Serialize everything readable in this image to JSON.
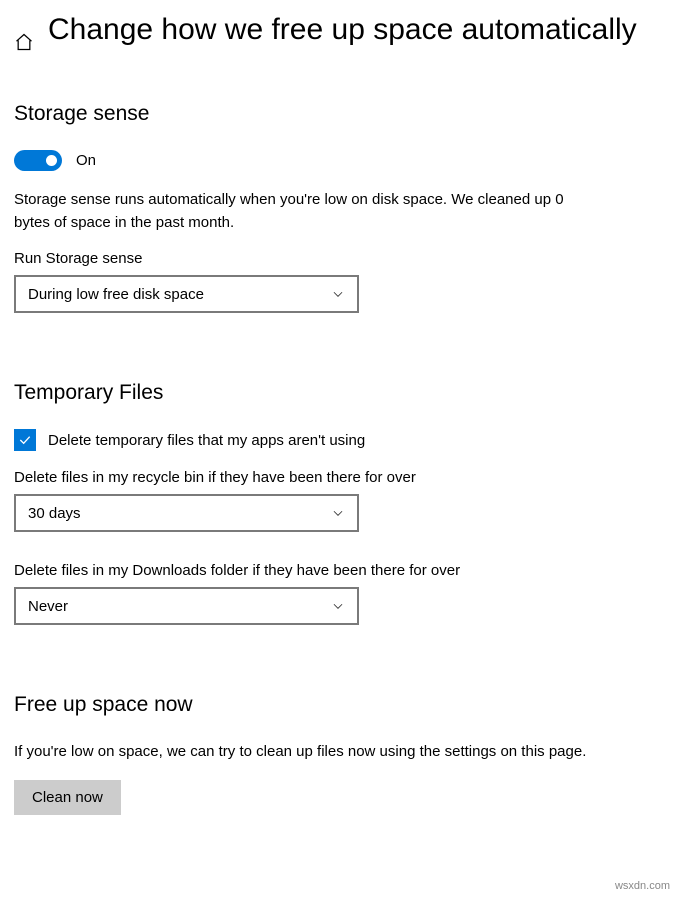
{
  "header": {
    "title": "Change how we free up space automatically"
  },
  "storageSense": {
    "heading": "Storage sense",
    "toggleLabel": "On",
    "description": "Storage sense runs automatically when you're low on disk space. We cleaned up 0 bytes of space in the past month.",
    "runLabel": "Run Storage sense",
    "runValue": "During low free disk space"
  },
  "temporaryFiles": {
    "heading": "Temporary Files",
    "checkboxLabel": "Delete temporary files that my apps aren't using",
    "recycleBinLabel": "Delete files in my recycle bin if they have been there for over",
    "recycleBinValue": "30 days",
    "downloadsLabel": "Delete files in my Downloads folder if they have been there for over",
    "downloadsValue": "Never"
  },
  "freeUpSpace": {
    "heading": "Free up space now",
    "description": "If you're low on space, we can try to clean up files now using the settings on this page.",
    "buttonLabel": "Clean now"
  },
  "watermark": "wsxdn.com"
}
